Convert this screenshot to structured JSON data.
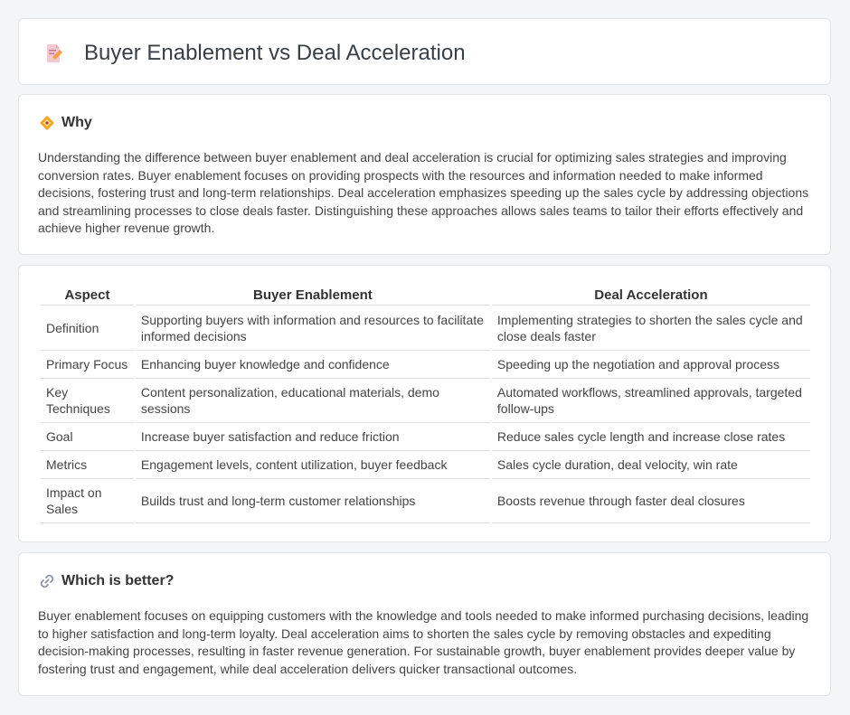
{
  "header": {
    "title": "Buyer Enablement vs Deal Acceleration",
    "icon": "document-edit-icon"
  },
  "why": {
    "icon": "diamond-sparkle-icon",
    "heading": "Why",
    "text": "Understanding the difference between buyer enablement and deal acceleration is crucial for optimizing sales strategies and improving conversion rates. Buyer enablement focuses on providing prospects with the resources and information needed to make informed decisions, fostering trust and long-term relationships. Deal acceleration emphasizes speeding up the sales cycle by addressing objections and streamlining processes to close deals faster. Distinguishing these approaches allows sales teams to tailor their efforts effectively and achieve higher revenue growth."
  },
  "table": {
    "headers": [
      "Aspect",
      "Buyer Enablement",
      "Deal Acceleration"
    ],
    "rows": [
      [
        "Definition",
        "Supporting buyers with information and resources to facilitate informed decisions",
        "Implementing strategies to shorten the sales cycle and close deals faster"
      ],
      [
        "Primary Focus",
        "Enhancing buyer knowledge and confidence",
        "Speeding up the negotiation and approval process"
      ],
      [
        "Key Techniques",
        "Content personalization, educational materials, demo sessions",
        "Automated workflows, streamlined approvals, targeted follow-ups"
      ],
      [
        "Goal",
        "Increase buyer satisfaction and reduce friction",
        "Reduce sales cycle length and increase close rates"
      ],
      [
        "Metrics",
        "Engagement levels, content utilization, buyer feedback",
        "Sales cycle duration, deal velocity, win rate"
      ],
      [
        "Impact on Sales",
        "Builds trust and long-term customer relationships",
        "Boosts revenue through faster deal closures"
      ]
    ]
  },
  "better": {
    "icon": "link-icon",
    "heading": "Which is better?",
    "text": "Buyer enablement focuses on equipping customers with the knowledge and tools needed to make informed purchasing decisions, leading to higher satisfaction and long-term loyalty. Deal acceleration aims to shorten the sales cycle by removing obstacles and expediting decision-making processes, resulting in faster revenue generation. For sustainable growth, buyer enablement provides deeper value by fostering trust and engagement, while deal acceleration delivers quicker transactional outcomes."
  }
}
